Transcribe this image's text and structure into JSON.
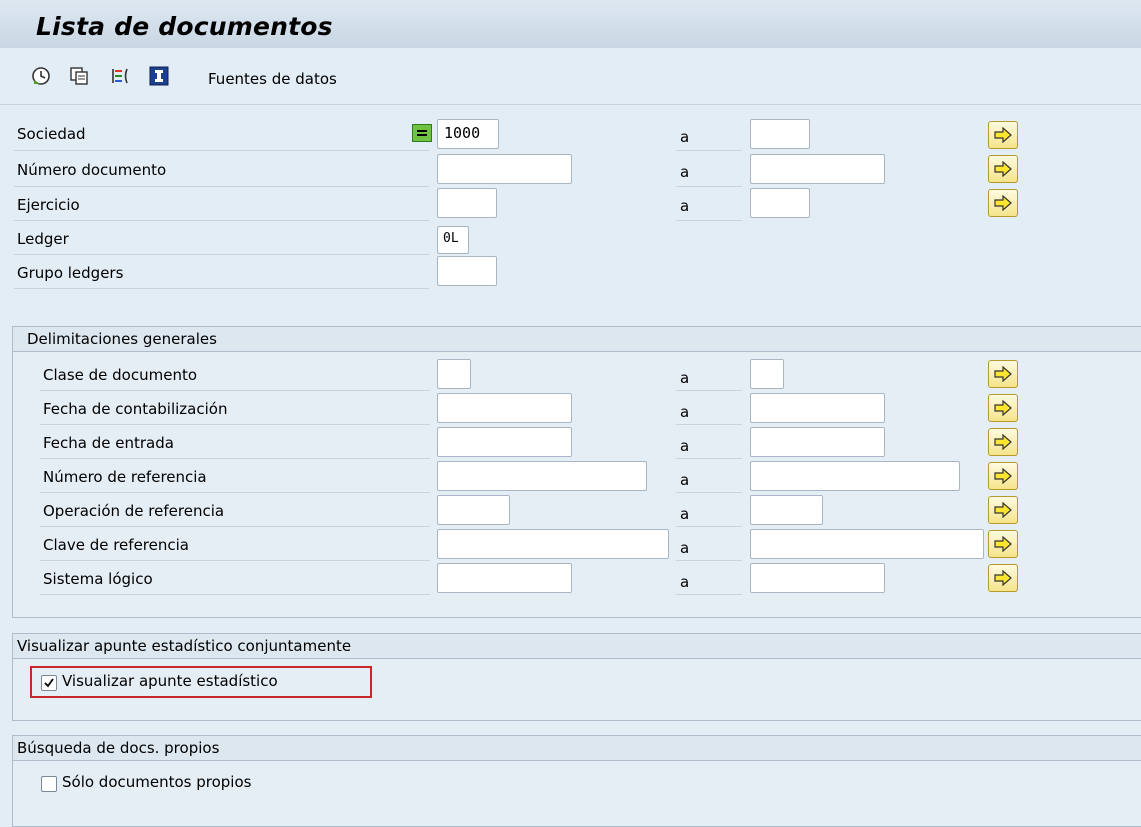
{
  "title": "Lista de documentos",
  "toolbar": {
    "items": [
      {
        "icon": "execute-clock-icon"
      },
      {
        "icon": "copy-variant-icon"
      },
      {
        "icon": "selection-options-icon"
      },
      {
        "icon": "info-icon"
      }
    ],
    "data_sources_label": "Fuentes de datos"
  },
  "main": {
    "fields": [
      {
        "label": "Sociedad",
        "from": "1000",
        "to": ""
      },
      {
        "label": "Número documento",
        "from": "",
        "to": ""
      },
      {
        "label": "Ejercicio",
        "from": "",
        "to": ""
      },
      {
        "label": "Ledger",
        "from": "0L"
      },
      {
        "label": "Grupo ledgers",
        "from": ""
      }
    ]
  },
  "range_separator": "a",
  "general": {
    "title": "Delimitaciones generales",
    "fields": [
      {
        "label": "Clase de documento",
        "from": "",
        "to": ""
      },
      {
        "label": "Fecha de contabilización",
        "from": "",
        "to": ""
      },
      {
        "label": "Fecha de entrada",
        "from": "",
        "to": ""
      },
      {
        "label": "Número de referencia",
        "from": "",
        "to": ""
      },
      {
        "label": "Operación de referencia",
        "from": "",
        "to": ""
      },
      {
        "label": "Clave de referencia",
        "from": "",
        "to": ""
      },
      {
        "label": "Sistema lógico",
        "from": "",
        "to": ""
      }
    ]
  },
  "statistical": {
    "title": "Visualizar apunte estadístico conjuntamente",
    "checkbox_label": "Visualizar apunte estadístico",
    "checked": true
  },
  "own_docs": {
    "title": "Búsqueda de docs. propios",
    "checkbox_label": "Sólo documentos propios",
    "checked": false
  },
  "colors": {
    "background": "#e3edf5",
    "highlight": "#c62828",
    "arrow_button": "#f5e48a"
  }
}
